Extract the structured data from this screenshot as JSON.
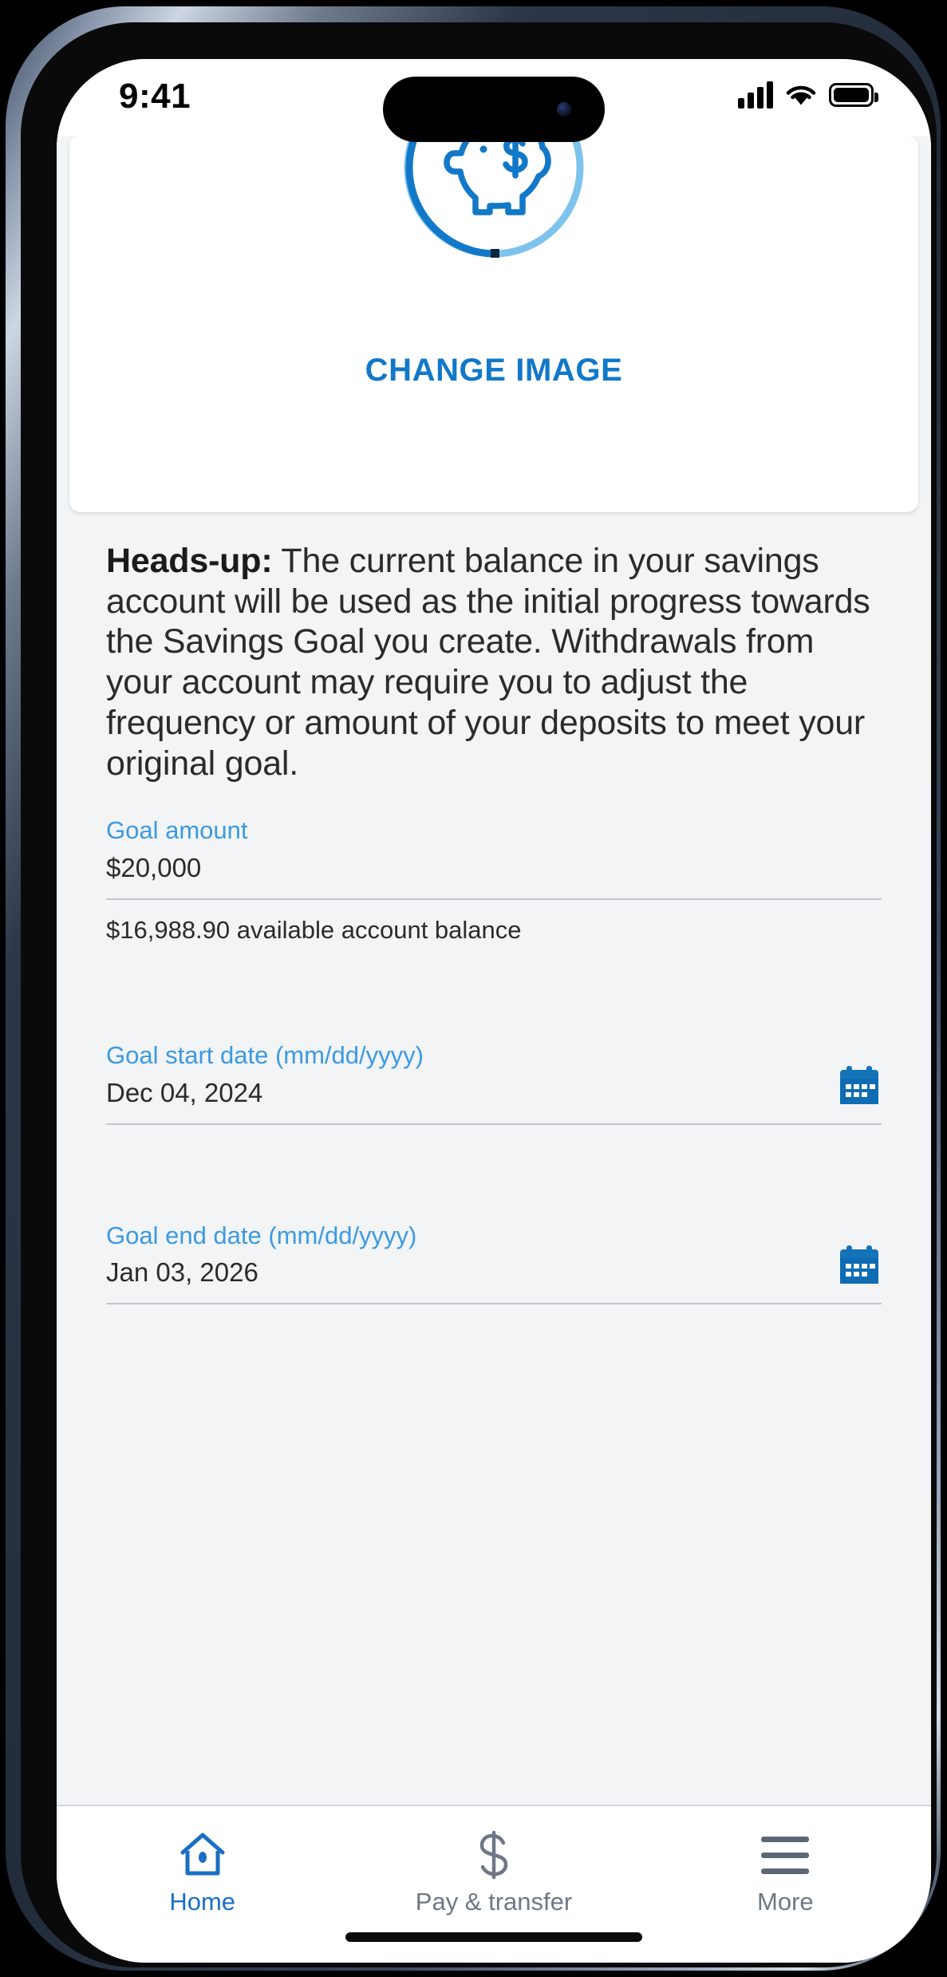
{
  "status_bar": {
    "time": "9:41",
    "cellular_icon": "cellular-bars-icon",
    "wifi_icon": "wifi-icon",
    "battery_icon": "battery-full-icon"
  },
  "image_card": {
    "goal_icon": "piggy-bank-icon",
    "progress_ring": {
      "filled_color": "#1278c8",
      "track_color": "#7ec2ee",
      "percent": 85
    },
    "change_image_label": "CHANGE IMAGE"
  },
  "form": {
    "headsup_label": "Heads-up:",
    "headsup_text": " The current balance in your savings account will be used as the initial progress towards the Savings Goal you create. Withdrawals from your account may require you to adjust the frequency or amount of your deposits to meet your original goal.",
    "goal_amount": {
      "label": "Goal amount",
      "value": "$20,000",
      "helper": "$16,988.90 available account balance"
    },
    "goal_start_date": {
      "label": "Goal start date (mm/dd/yyyy)",
      "value": "Dec 04, 2024",
      "icon": "calendar-icon"
    },
    "goal_end_date": {
      "label": "Goal end date (mm/dd/yyyy)",
      "value": "Jan 03, 2026",
      "icon": "calendar-icon"
    }
  },
  "tab_bar": {
    "tabs": [
      {
        "label": "Home",
        "icon": "home-icon",
        "active": true
      },
      {
        "label": "Pay & transfer",
        "icon": "dollar-sign-icon",
        "active": false
      },
      {
        "label": "More",
        "icon": "hamburger-menu-icon",
        "active": false
      }
    ]
  },
  "colors": {
    "brand_blue": "#1278c8",
    "label_blue": "#3c9ae0",
    "active_tab": "#1a6fc4",
    "inactive_tab": "#6f7785",
    "page_bg": "#f2f4f6"
  }
}
